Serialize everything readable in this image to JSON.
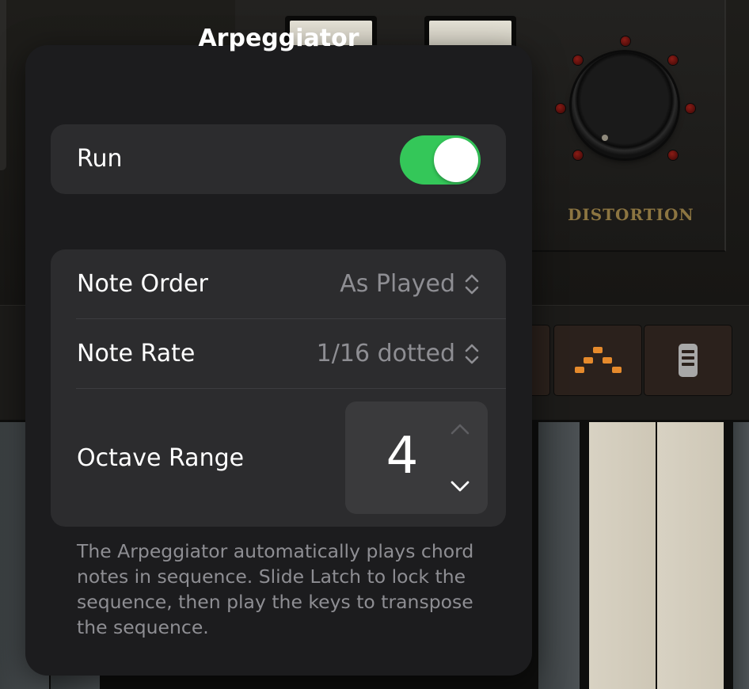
{
  "background": {
    "fx_label": "DISTORTION",
    "arp_button_icon": "arpeggio-pattern-icon",
    "settings_button_icon": "drawbar-settings-icon"
  },
  "popover": {
    "title": "Arpeggiator",
    "run": {
      "label": "Run",
      "enabled": true
    },
    "note_order": {
      "label": "Note Order",
      "value": "As Played"
    },
    "note_rate": {
      "label": "Note Rate",
      "value": "1/16 dotted"
    },
    "octave_range": {
      "label": "Octave Range",
      "value": "4"
    },
    "description": "The Arpeggiator automatically plays chord notes in sequence. Slide Latch to lock the sequence, then play the keys to transpose the sequence."
  },
  "colors": {
    "toggle_on": "#34c759",
    "popover_bg": "#1c1c1e",
    "group_bg": "#2c2c2e",
    "secondary_text": "#8e8e93",
    "accent_orange": "#e58a2c",
    "distortion_gold": "#8c7541"
  }
}
